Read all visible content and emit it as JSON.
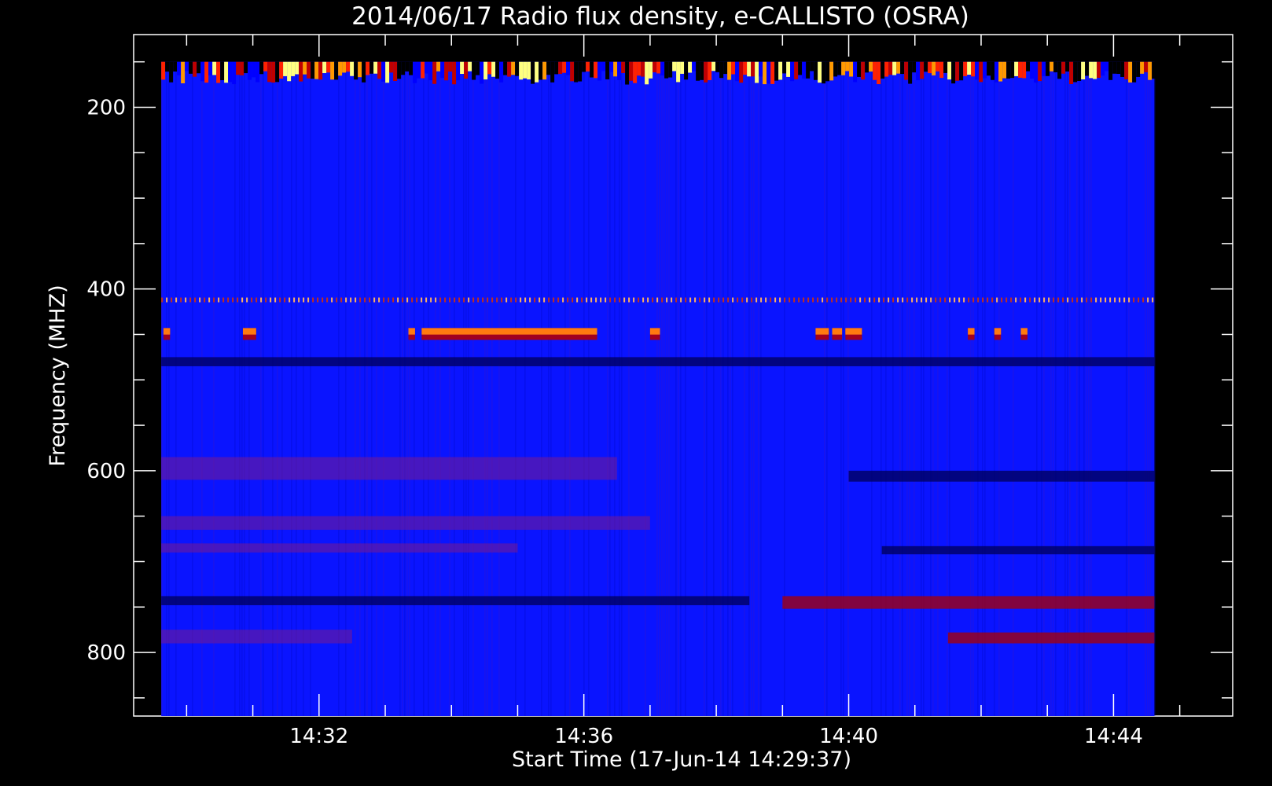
{
  "chart_data": {
    "type": "heatmap",
    "title": "2014/06/17  Radio flux density, e-CALLISTO (OSRA)",
    "xlabel": "Start Time (17-Jun-14 14:29:37)",
    "ylabel": "Frequency (MHZ)",
    "x_ticks": [
      "14:32",
      "14:36",
      "14:40",
      "14:44"
    ],
    "x_tick_minutes": [
      32,
      36,
      40,
      44
    ],
    "x_minor_tick_minutes": [
      30,
      31,
      33,
      34,
      35,
      37,
      38,
      39,
      41,
      42,
      43,
      45
    ],
    "y_ticks": [
      200,
      400,
      600,
      800
    ],
    "y_minor_ticks": [
      150,
      250,
      300,
      350,
      450,
      500,
      550,
      650,
      700,
      750,
      850
    ],
    "xlim_minutes": [
      29.2,
      45.8
    ],
    "ylim_mhz": [
      870,
      120
    ],
    "data_time_range_minutes": [
      29.617,
      44.617
    ],
    "data_freq_range_mhz": [
      150,
      870
    ],
    "colorscale": [
      "#000000",
      "#00008c",
      "#0000ff",
      "#4b1fd6",
      "#8c0000",
      "#ff2200",
      "#ff8800",
      "#ffff80"
    ],
    "background_color": "#0a14ff",
    "features": [
      {
        "name": "top interference band",
        "freq_range": [
          150,
          175
        ],
        "time_range": [
          29.617,
          44.617
        ],
        "level": "bursty"
      },
      {
        "name": "emission line",
        "freq": 412,
        "time_range": [
          29.617,
          44.617
        ],
        "level": "dotted"
      },
      {
        "name": "burst segments",
        "freq_range": [
          443,
          456
        ],
        "time_segments": [
          [
            29.65,
            29.75
          ],
          [
            30.85,
            31.05
          ],
          [
            33.35,
            33.45
          ],
          [
            33.55,
            36.2
          ],
          [
            37.0,
            37.15
          ],
          [
            39.5,
            39.7
          ],
          [
            39.75,
            39.9
          ],
          [
            39.95,
            40.2
          ],
          [
            41.8,
            41.9
          ],
          [
            42.2,
            42.3
          ],
          [
            42.6,
            42.7
          ]
        ],
        "level": "strong"
      },
      {
        "name": "dark striped band",
        "freq_range": [
          475,
          485
        ],
        "time_range": [
          29.617,
          44.617
        ],
        "level": "dark"
      },
      {
        "name": "reddish band",
        "freq_range": [
          585,
          610
        ],
        "time_range": [
          29.617,
          36.5
        ],
        "level": "weak"
      },
      {
        "name": "reddish band",
        "freq_range": [
          650,
          665
        ],
        "time_range": [
          29.617,
          37.0
        ],
        "level": "weak"
      },
      {
        "name": "reddish band",
        "freq_range": [
          680,
          690
        ],
        "time_range": [
          29.617,
          35.0
        ],
        "level": "weak"
      },
      {
        "name": "dark band",
        "freq_range": [
          738,
          748
        ],
        "time_range": [
          29.617,
          38.5
        ],
        "level": "dark"
      },
      {
        "name": "red band",
        "freq_range": [
          738,
          752
        ],
        "time_range": [
          39.0,
          44.617
        ],
        "level": "moderate"
      },
      {
        "name": "reddish band",
        "freq_range": [
          775,
          790
        ],
        "time_range": [
          29.617,
          32.5
        ],
        "level": "weak"
      },
      {
        "name": "reddish band",
        "freq_range": [
          778,
          790
        ],
        "time_range": [
          41.5,
          44.617
        ],
        "level": "moderate"
      },
      {
        "name": "dark band",
        "freq_range": [
          600,
          612
        ],
        "time_range": [
          40.0,
          44.617
        ],
        "level": "dark"
      },
      {
        "name": "dark band",
        "freq_range": [
          683,
          692
        ],
        "time_range": [
          40.5,
          44.617
        ],
        "level": "dark"
      }
    ]
  }
}
